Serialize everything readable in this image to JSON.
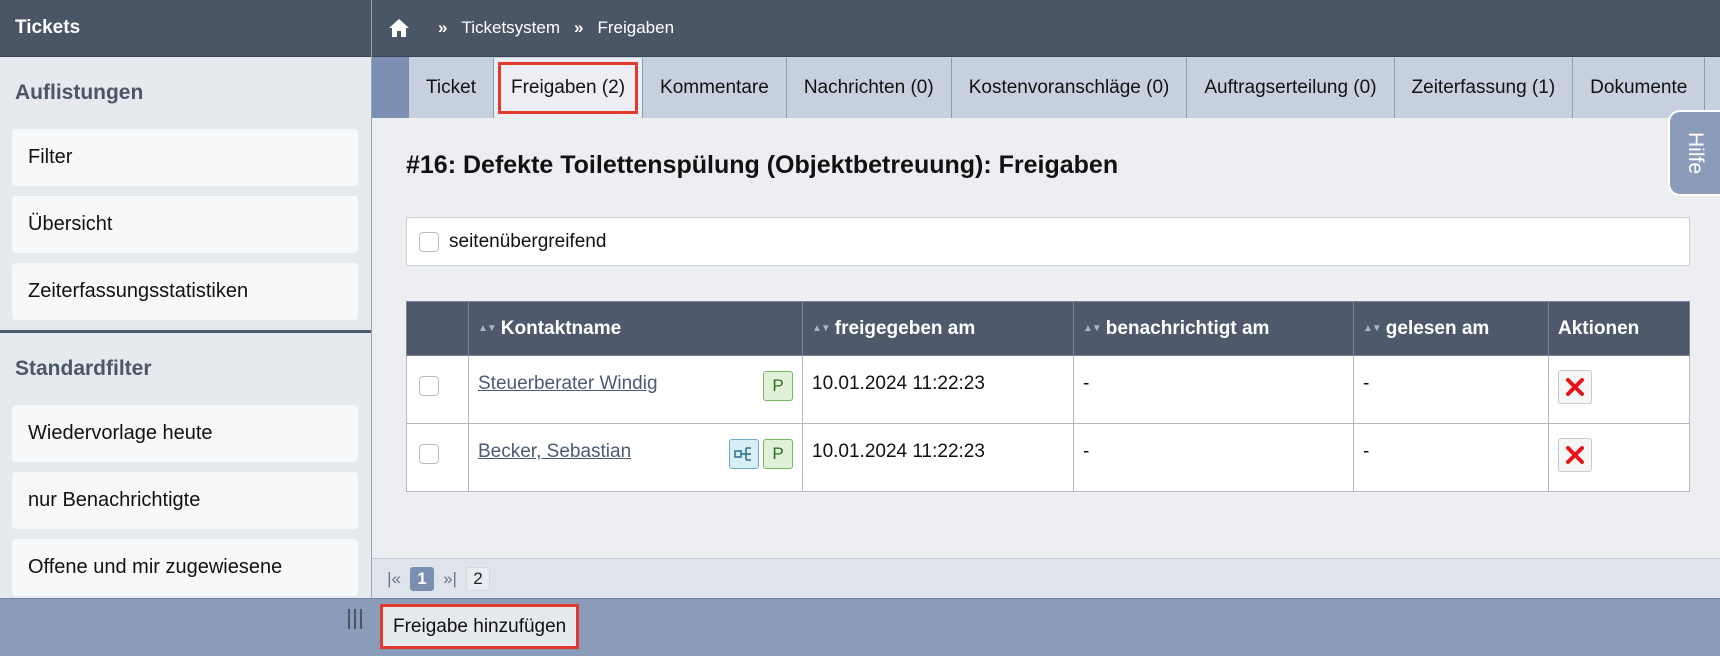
{
  "sidebar": {
    "title": "Tickets",
    "section1": "Auflistungen",
    "items1": [
      "Filter",
      "Übersicht",
      "Zeiterfassungsstatistiken"
    ],
    "section2": "Standardfilter",
    "items2": [
      "Wiedervorlage heute",
      "nur Benachrichtigte",
      "Offene und mir zugewiesene"
    ]
  },
  "breadcrumb": {
    "sep": "»",
    "items": [
      "Ticketsystem",
      "Freigaben"
    ]
  },
  "tabs": [
    {
      "label": "Ticket"
    },
    {
      "label": "Freigaben (2)",
      "active": true
    },
    {
      "label": "Kommentare"
    },
    {
      "label": "Nachrichten (0)"
    },
    {
      "label": "Kostenvoranschläge (0)"
    },
    {
      "label": "Auftragserteilung (0)"
    },
    {
      "label": "Zeiterfassung (1)"
    },
    {
      "label": "Dokumente"
    }
  ],
  "help_label": "Hilfe",
  "page_title": "#16: Defekte Toilettenspülung (Objektbetreuung): Freigaben",
  "cross_page_label": "seitenübergreifend",
  "table": {
    "headers": {
      "contact": "Kontaktname",
      "released": "freigegeben am",
      "notified": "benachrichtigt am",
      "read": "gelesen am",
      "actions": "Aktionen"
    },
    "rows": [
      {
        "name": "Steuerberater Windig",
        "released": "10.01.2024 11:22:23",
        "notified": "-",
        "read": "-",
        "badge_p": "P",
        "share": false
      },
      {
        "name": "Becker, Sebastian",
        "released": "10.01.2024 11:22:23",
        "notified": "-",
        "read": "-",
        "badge_p": "P",
        "share": true
      }
    ]
  },
  "pager": {
    "first": "|«",
    "current": "1",
    "last": "»|",
    "total": "2"
  },
  "add_button": "Freigabe hinzufügen",
  "colors": {
    "header_dark": "#4a5566",
    "accent": "#8b9cbb",
    "highlight": "#e23a2f",
    "delete": "#e8141c"
  }
}
